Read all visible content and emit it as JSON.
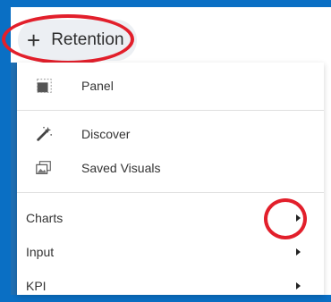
{
  "header": {
    "plus_icon": "+",
    "title": "Retention"
  },
  "menu": {
    "items": [
      {
        "label": "Panel",
        "icon": "panel-icon"
      },
      {
        "label": "Discover",
        "icon": "magic-wand-icon"
      },
      {
        "label": "Saved Visuals",
        "icon": "saved-visuals-icon"
      },
      {
        "label": "Charts",
        "has_submenu": true
      },
      {
        "label": "Input",
        "has_submenu": true
      },
      {
        "label": "KPI",
        "has_submenu": true
      }
    ]
  },
  "colors": {
    "frame_blue": "#0a6fc4",
    "highlight_red": "#e21f2b"
  }
}
